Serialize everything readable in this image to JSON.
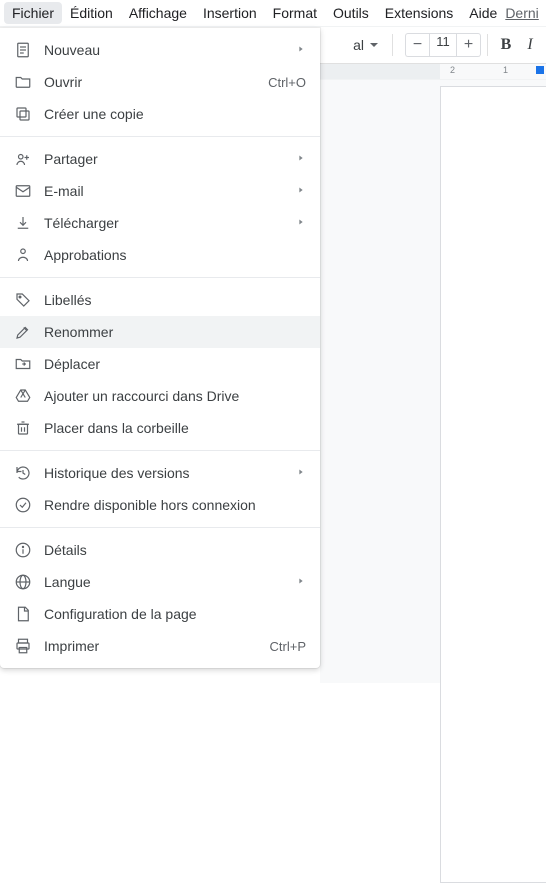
{
  "menubar": {
    "items": [
      "Fichier",
      "Édition",
      "Affichage",
      "Insertion",
      "Format",
      "Outils",
      "Extensions",
      "Aide"
    ],
    "active_index": 0,
    "last_modified_label": "Derni"
  },
  "toolbar": {
    "style_select": "al",
    "font_size": "11",
    "bold_glyph": "B",
    "italic_glyph": "I"
  },
  "ruler": {
    "tick_neg_2": "2",
    "tick_neg_1": "1"
  },
  "file_menu": [
    {
      "icon": "doc",
      "label": "Nouveau",
      "hint": "",
      "submenu": true
    },
    {
      "icon": "folder",
      "label": "Ouvrir",
      "hint": "Ctrl+O",
      "submenu": false
    },
    {
      "icon": "copy",
      "label": "Créer une copie",
      "hint": "",
      "submenu": false
    },
    {
      "separator": true
    },
    {
      "icon": "share",
      "label": "Partager",
      "hint": "",
      "submenu": true
    },
    {
      "icon": "mail",
      "label": "E-mail",
      "hint": "",
      "submenu": true
    },
    {
      "icon": "download",
      "label": "Télécharger",
      "hint": "",
      "submenu": true
    },
    {
      "icon": "approve",
      "label": "Approbations",
      "hint": "",
      "submenu": false
    },
    {
      "separator": true
    },
    {
      "icon": "tag",
      "label": "Libellés",
      "hint": "",
      "submenu": false
    },
    {
      "icon": "rename",
      "label": "Renommer",
      "hint": "",
      "submenu": false,
      "hover": true
    },
    {
      "icon": "move",
      "label": "Déplacer",
      "hint": "",
      "submenu": false
    },
    {
      "icon": "drive",
      "label": "Ajouter un raccourci dans Drive",
      "hint": "",
      "submenu": false
    },
    {
      "icon": "trash",
      "label": "Placer dans la corbeille",
      "hint": "",
      "submenu": false
    },
    {
      "separator": true
    },
    {
      "icon": "history",
      "label": "Historique des versions",
      "hint": "",
      "submenu": true
    },
    {
      "icon": "offline",
      "label": "Rendre disponible hors connexion",
      "hint": "",
      "submenu": false
    },
    {
      "separator": true
    },
    {
      "icon": "info",
      "label": "Détails",
      "hint": "",
      "submenu": false
    },
    {
      "icon": "globe",
      "label": "Langue",
      "hint": "",
      "submenu": true
    },
    {
      "icon": "page",
      "label": "Configuration de la page",
      "hint": "",
      "submenu": false
    },
    {
      "icon": "print",
      "label": "Imprimer",
      "hint": "Ctrl+P",
      "submenu": false
    }
  ]
}
